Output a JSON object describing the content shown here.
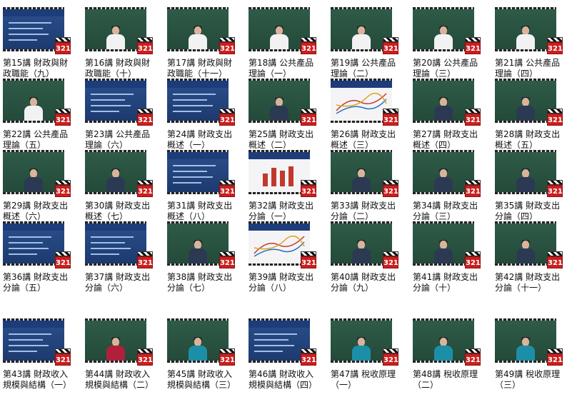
{
  "badge_text": "321",
  "colors": {
    "board": "#2f5b48",
    "badge": "#cc1f1f",
    "slide_blue": "#2a4f8c"
  },
  "lectures": [
    {
      "label": "第15講 財政與財政職能（九）",
      "thumb": "slide-blue"
    },
    {
      "label": "第16講 財政與財政職能（十）",
      "thumb": "board-white-shirt"
    },
    {
      "label": "第17講 財政與財政職能（十一）",
      "thumb": "board-white-shirt"
    },
    {
      "label": "第18講 公共產品理論（一）",
      "thumb": "board-white-shirt"
    },
    {
      "label": "第19講 公共產品理論（二）",
      "thumb": "board-white-shirt"
    },
    {
      "label": "第20講 公共產品理論（三）",
      "thumb": "board-white-shirt"
    },
    {
      "label": "第21講 公共產品理論（四）",
      "thumb": "board-white-shirt"
    },
    {
      "label": "第22講 公共產品理論（五）",
      "thumb": "board-white-shirt"
    },
    {
      "label": "第23講 公共產品理論（六）",
      "thumb": "slide-blue"
    },
    {
      "label": "第24講 財政支出概述（一）",
      "thumb": "slide-blue"
    },
    {
      "label": "第25講 財政支出概述（二）",
      "thumb": "board-dark-shirt"
    },
    {
      "label": "第26講 財政支出概述（三）",
      "thumb": "slide-chart"
    },
    {
      "label": "第27講 財政支出概述（四）",
      "thumb": "board-dark-shirt"
    },
    {
      "label": "第28講 財政支出概述（五）",
      "thumb": "board-dark-shirt"
    },
    {
      "label": "第29講 財政支出概述（六）",
      "thumb": "board-dark-shirt"
    },
    {
      "label": "第30講 財政支出概述（七）",
      "thumb": "board-dark-shirt"
    },
    {
      "label": "第31講 財政支出概述（八）",
      "thumb": "slide-blue"
    },
    {
      "label": "第32講 財政支出分論（一）",
      "thumb": "slide-bars"
    },
    {
      "label": "第33講 財政支出分論（二）",
      "thumb": "board-dark-shirt"
    },
    {
      "label": "第34講 財政支出分論（三）",
      "thumb": "board-dark-shirt"
    },
    {
      "label": "第35講 財政支出分論（四）",
      "thumb": "board-dark-shirt"
    },
    {
      "label": "第36講 財政支出分論（五）",
      "thumb": "slide-blue"
    },
    {
      "label": "第37講 財政支出分論（六）",
      "thumb": "slide-blue"
    },
    {
      "label": "第38講 財政支出分論（七）",
      "thumb": "board-dark-shirt"
    },
    {
      "label": "第39講 財政支出分論（八）",
      "thumb": "slide-chart"
    },
    {
      "label": "第40講 財政支出分論（九）",
      "thumb": "board-dark-shirt"
    },
    {
      "label": "第41講 財政支出分論（十）",
      "thumb": "board-dark-shirt"
    },
    {
      "label": "第42講 財政支出分論（十一）",
      "thumb": "board-dark-shirt"
    },
    {
      "label": "第43講 財政收入規模與結構（一）",
      "thumb": "slide-blue"
    },
    {
      "label": "第44講 財政收入規模與結構（二）",
      "thumb": "board-red-shirt"
    },
    {
      "label": "第45講 財政收入規模與結構（三）",
      "thumb": "board-teal-shirt"
    },
    {
      "label": "第46講 財政收入規模與結構（四）",
      "thumb": "slide-blue"
    },
    {
      "label": "第47講 稅收原理（一）",
      "thumb": "board-teal-shirt"
    },
    {
      "label": "第48講 稅收原理（二）",
      "thumb": "board-teal-shirt"
    },
    {
      "label": "第49講 稅收原理（三）",
      "thumb": "board-teal-shirt"
    }
  ]
}
